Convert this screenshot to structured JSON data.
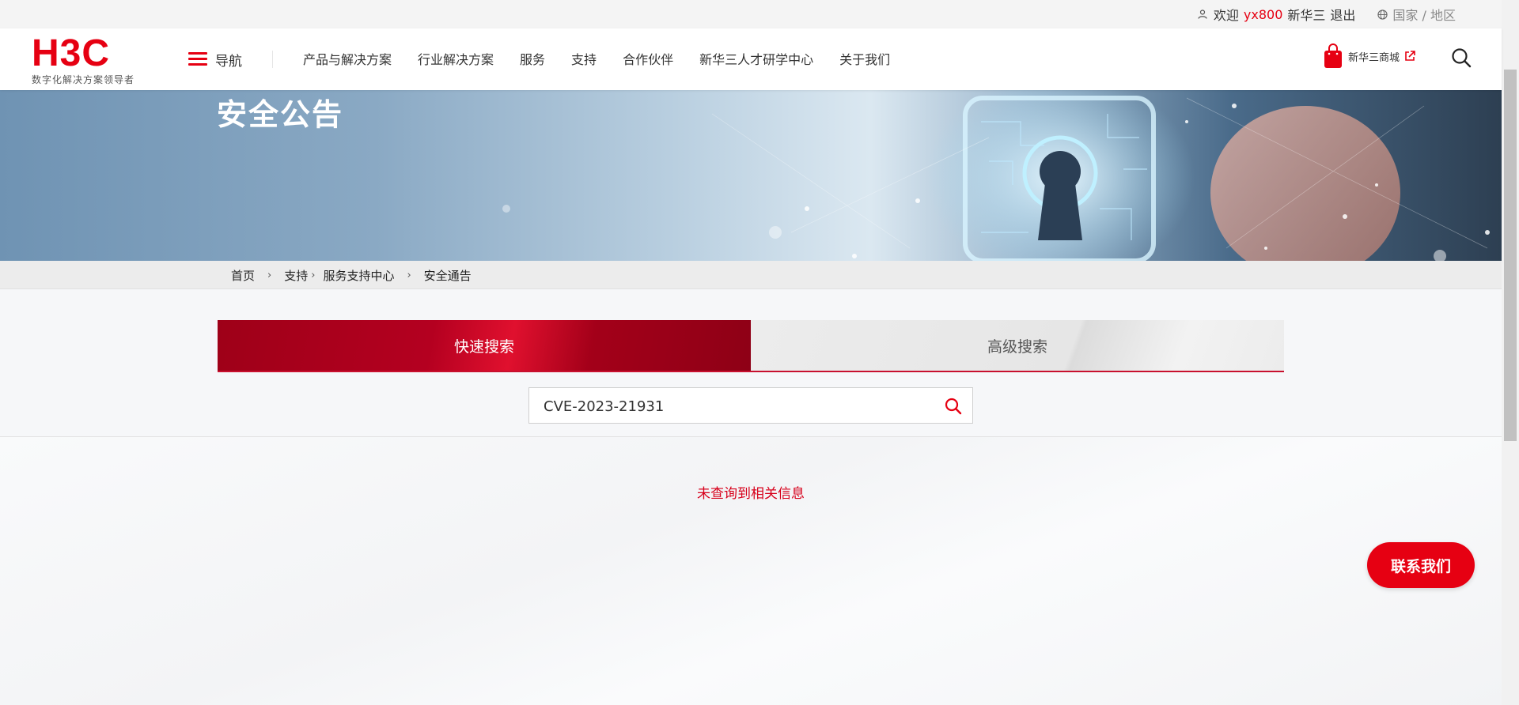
{
  "topbar": {
    "welcome": "欢迎",
    "username": "yx800",
    "company": "新华三",
    "logout": "退出",
    "region": "国家 / 地区"
  },
  "header": {
    "logo_text": "H3C",
    "logo_tagline": "数字化解决方案领导者",
    "nav_toggle": "导航",
    "nav_items": [
      "产品与解决方案",
      "行业解决方案",
      "服务",
      "支持",
      "合作伙伴",
      "新华三人才研学中心",
      "关于我们"
    ],
    "shop_label": "新华三商城"
  },
  "banner": {
    "title": "安全公告"
  },
  "breadcrumb": [
    "首页",
    "支持",
    "服务支持中心",
    "安全通告"
  ],
  "search": {
    "tabs": [
      "快速搜索",
      "高级搜索"
    ],
    "active_tab": "快速搜索",
    "query": "CVE-2023-21931",
    "no_result": "未查询到相关信息"
  },
  "contact_label": "联系我们",
  "colors": {
    "brand": "#e60012",
    "tab_active": "#b40020"
  },
  "icons": [
    "user-icon",
    "globe-icon",
    "menu-icon",
    "shopping-bag-icon",
    "external-link-icon",
    "search-icon"
  ]
}
